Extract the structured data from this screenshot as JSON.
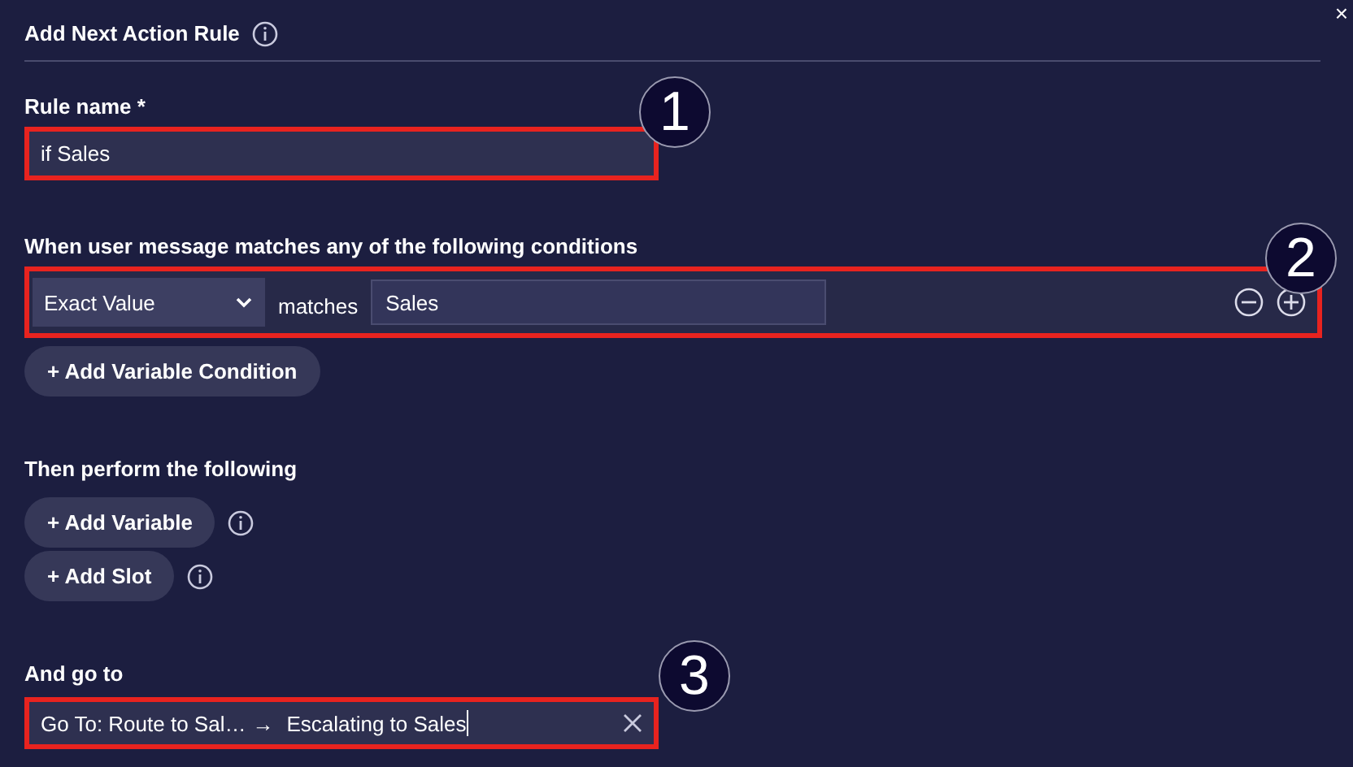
{
  "dialog": {
    "title": "Add Next Action Rule",
    "close": "×"
  },
  "rule_name": {
    "label": "Rule name *",
    "value": "if Sales"
  },
  "conditions": {
    "label": "When user message matches any of the following conditions",
    "rows": [
      {
        "match_type": "Exact Value",
        "operator": "matches",
        "value": "Sales"
      }
    ],
    "add_button": "+ Add Variable Condition"
  },
  "actions": {
    "label": "Then perform the following",
    "buttons": [
      "+ Add Variable",
      "+ Add Slot"
    ]
  },
  "go_to": {
    "label": "And go to",
    "target": "Go To: Route to Sal…",
    "arrow": "→",
    "value": "Escalating to Sales"
  },
  "callouts": [
    "1",
    "2",
    "3"
  ]
}
